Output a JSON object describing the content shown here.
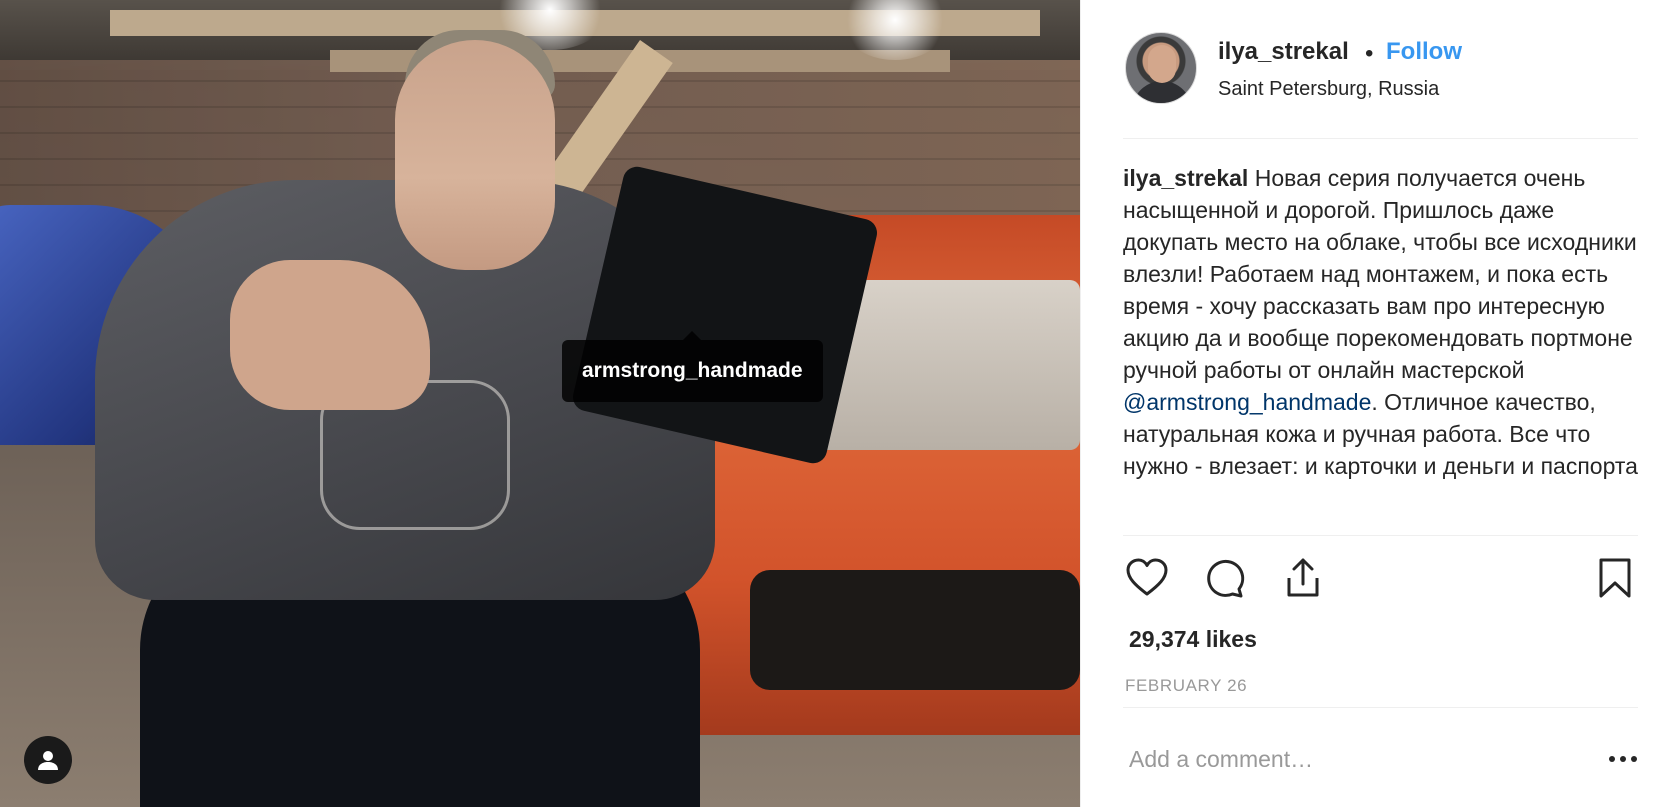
{
  "photo": {
    "tag_label": "armstrong_handmade",
    "tags_icon": "user-icon"
  },
  "header": {
    "username": "ilya_strekal",
    "separator": "•",
    "follow_label": "Follow",
    "location": "Saint Petersburg, Russia"
  },
  "caption": {
    "username": "ilya_strekal",
    "text_before_mention": "Новая серия получается очень насыщенной и дорогой. Пришлось даже докупать место на облаке, чтобы все исходники влезли! Работаем над монтажем, и пока есть время - хочу рассказать вам про интересную акцию да и вообще порекомендовать портмоне ручной работы от онлайн мастерской",
    "mention": "@armstrong_handmade",
    "text_after_mention": ". Отличное качество, натуральная кожа и ручная работа. Все что нужно - влезает: и карточки и деньги и паспорта"
  },
  "actions": {
    "like_icon": "heart-icon",
    "comment_icon": "comment-icon",
    "share_icon": "share-icon",
    "save_icon": "bookmark-icon"
  },
  "likes": "29,374 likes",
  "date": "FEBRUARY 26",
  "comment": {
    "placeholder": "Add a comment…",
    "value": "",
    "more_icon": "more-options-icon"
  },
  "colors": {
    "link_blue": "#3897f0",
    "mention_blue": "#003569",
    "text": "#262626",
    "muted": "#999999",
    "divider": "#efefef"
  }
}
